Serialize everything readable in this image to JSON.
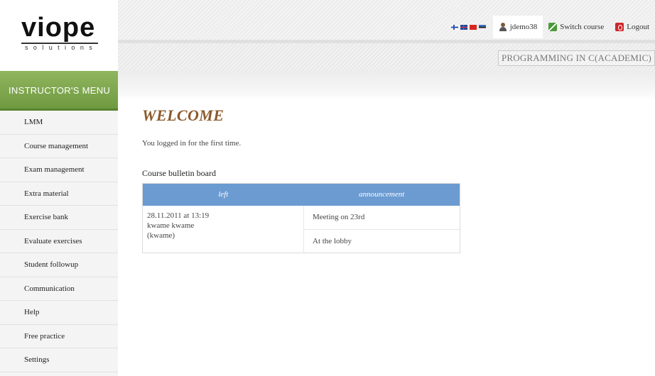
{
  "logo": {
    "word": "viope",
    "tagline": "solutions"
  },
  "topnav": {
    "flags": [
      "fi-flag-icon",
      "gb-flag-icon",
      "cn-flag-icon",
      "ee-flag-icon"
    ],
    "username": "jdemo38",
    "switch_course": "Switch course",
    "logout": "Logout"
  },
  "course_title": "PROGRAMMING IN C(ACADEMIC)",
  "sidebar": {
    "header": "INSTRUCTOR'S MENU",
    "items": [
      "LMM",
      "Course management",
      "Exam management",
      "Extra material",
      "Exercise bank",
      "Evaluate exercises",
      "Student followup",
      "Communication",
      "Help",
      "Free practice",
      "Settings"
    ]
  },
  "main": {
    "title": "WELCOME",
    "intro": "You logged in for the first time.",
    "board_title": "Course bulletin board",
    "columns": [
      "left",
      "announcement"
    ],
    "post": {
      "date": "28.11.2011 at 13:19",
      "author": "kwame kwame",
      "user": "(kwame)",
      "lines": [
        "Meeting on 23rd",
        "At the lobby"
      ]
    }
  },
  "colors": {
    "menu_header": "#7fa84e",
    "welcome": "#8b5a2b",
    "table_header": "#6b9bd1"
  }
}
